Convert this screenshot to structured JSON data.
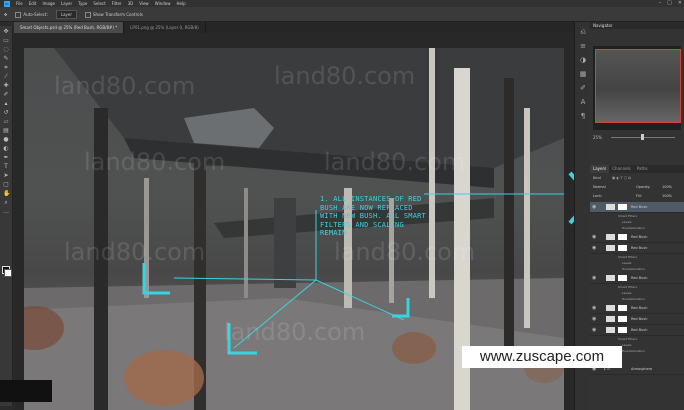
{
  "menubar": {
    "logo": "Ps",
    "items": [
      "File",
      "Edit",
      "Image",
      "Layer",
      "Type",
      "Select",
      "Filter",
      "3D",
      "View",
      "Window",
      "Help"
    ]
  },
  "options": {
    "auto_select_label": "Auto-Select:",
    "auto_select_value": "Layer",
    "transform_controls": "Show Transform Controls"
  },
  "tabs": [
    {
      "label": "Smart Objects.psd @ 25% (Red Bush, RGB/8#) *"
    },
    {
      "label": "LP01.png @ 25% (Layer 0, RGB/8)"
    }
  ],
  "right_panel": {
    "navigator_title": "Navigator",
    "zoom": "25%",
    "layers_tabs": [
      "Layers",
      "Channels",
      "Paths"
    ],
    "kind_label": "Kind",
    "blend_mode": "Normal",
    "opacity_label": "Opacity:",
    "opacity": "100%",
    "lock_label": "Lock:",
    "fill_label": "Fill:",
    "fill": "100%",
    "layers": [
      {
        "name": "Red Bush",
        "selected": true
      },
      {
        "sub": "Smart Filters"
      },
      {
        "sub": "Levels"
      },
      {
        "sub": "Hue/Saturation"
      },
      {
        "name": "Red Bush"
      },
      {
        "name": "Red Bush"
      },
      {
        "sub": "Smart Filters"
      },
      {
        "sub": "Levels"
      },
      {
        "sub": "Hue/Saturation"
      },
      {
        "name": "Red Bush"
      },
      {
        "sub": "Smart Filters"
      },
      {
        "sub": "Levels"
      },
      {
        "sub": "Hue/Saturation"
      },
      {
        "name": "Red Bush"
      },
      {
        "name": "Red Bush"
      },
      {
        "name": "Red Bush"
      },
      {
        "sub": "Smart Filters"
      },
      {
        "sub": "Levels"
      },
      {
        "sub": "Hue/Saturation"
      },
      {
        "name": "Atmosphere"
      }
    ]
  },
  "annotation": {
    "text": "1.  ALL INSTANCES OF RED BUSH ARE NOW REPLACED WITH NEW BUSH. ALL SMART FILTERS AND SCALING REMAIN"
  },
  "watermark": "land80.com",
  "website": "www.zuscape.com",
  "colors": {
    "accent": "#39d3e0",
    "selection": "#505a66"
  }
}
